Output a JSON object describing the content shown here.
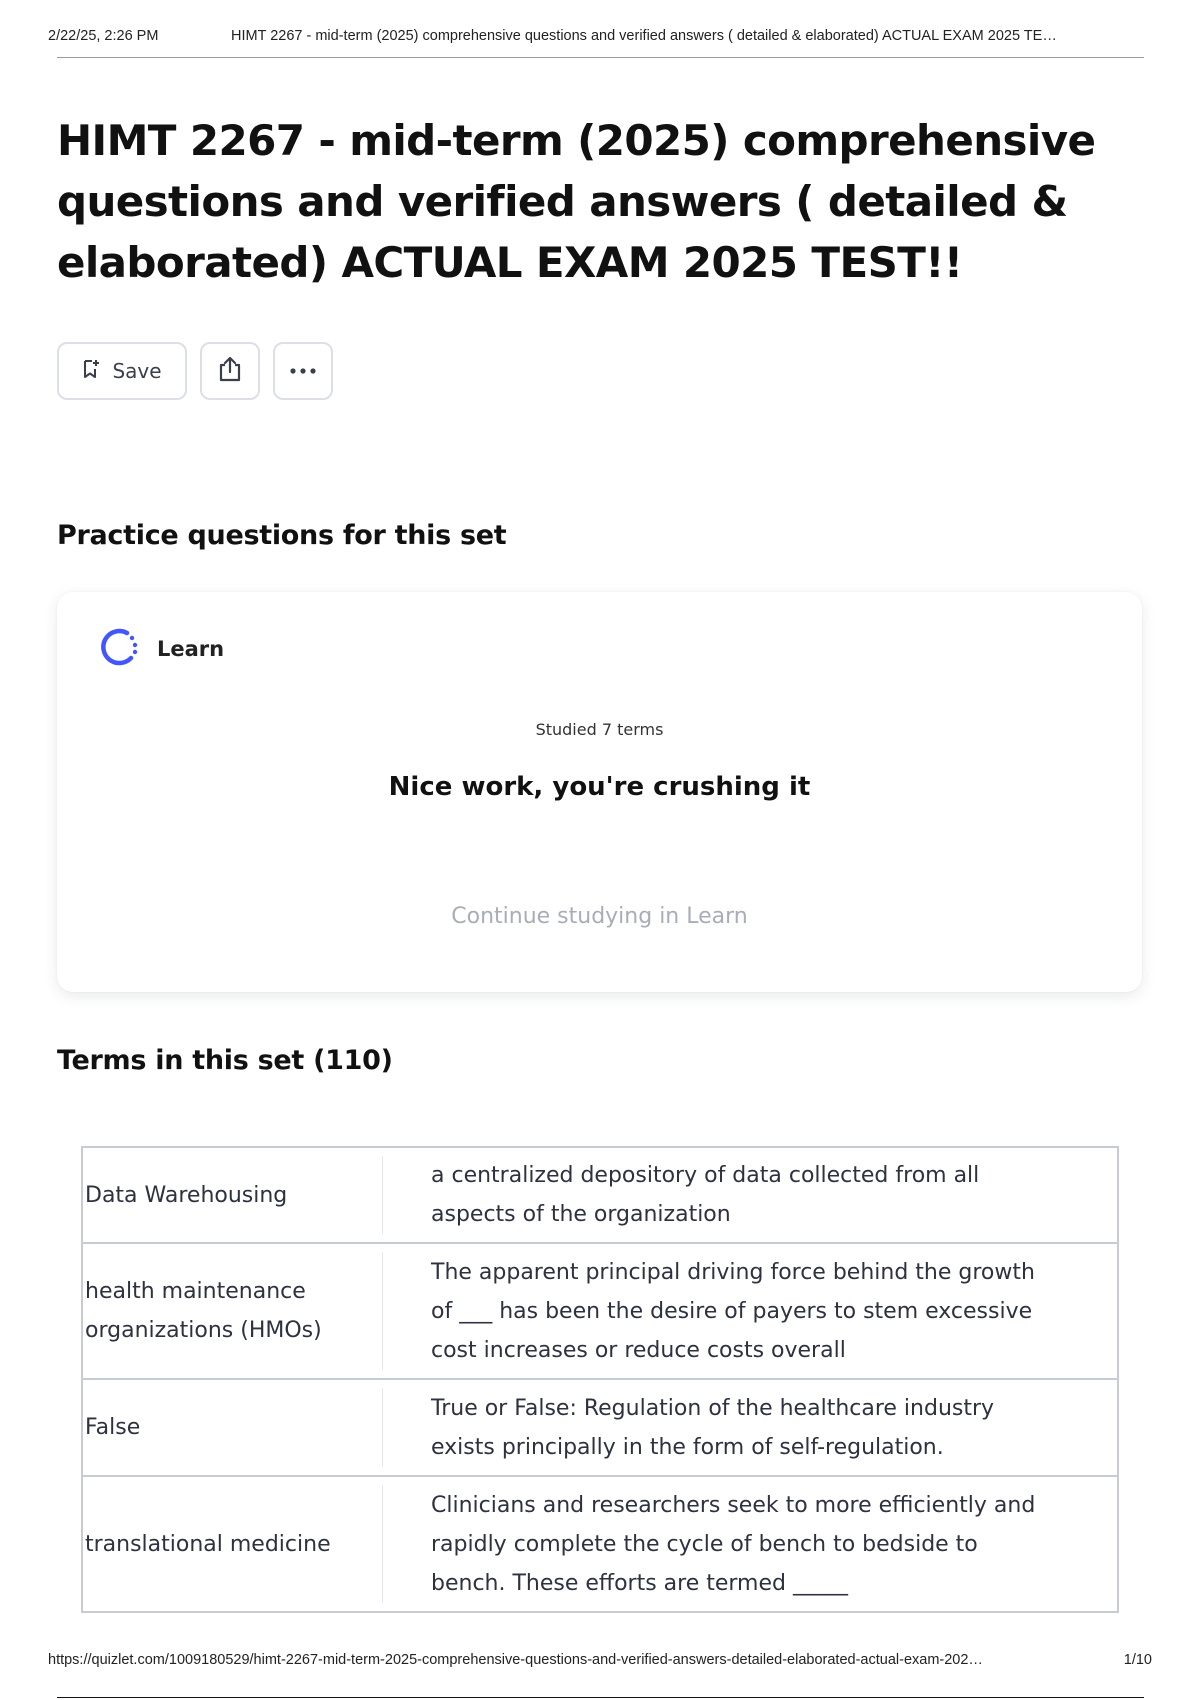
{
  "print_header": {
    "datetime": "2/22/25, 2:26 PM",
    "doc_title": "HIMT 2267 - mid-term (2025) comprehensive questions and verified answers ( detailed & elaborated) ACTUAL EXAM 2025 TE…"
  },
  "page": {
    "title": "HIMT 2267 - mid-term (2025) comprehensive questions and verified answers ( detailed & elaborated) ACTUAL EXAM 2025 TEST!!"
  },
  "actions": {
    "save_label": "Save",
    "save_icon": "bookmark-add-icon",
    "share_icon": "share-icon",
    "more_icon": "more-horizontal-icon"
  },
  "practice": {
    "heading": "Practice questions for this set",
    "learn_label": "Learn",
    "learn_icon": "learn-progress-icon",
    "accent_color": "#4255ff",
    "studied_text": "Studied 7 terms",
    "message": "Nice work, you're crushing it",
    "continue_label": "Continue studying in Learn"
  },
  "terms": {
    "heading": "Terms in this set (110)",
    "rows": [
      {
        "term": "Data Warehousing",
        "definition": "a centralized depository of data collected from all aspects of the organization"
      },
      {
        "term": "health maintenance organizations (HMOs)",
        "definition": "The apparent principal driving force behind the growth of ___ has been the desire of payers to stem excessive cost increases or reduce costs overall"
      },
      {
        "term": "False",
        "definition": "True or False: Regulation of the healthcare industry exists principally in the form of self-regulation."
      },
      {
        "term": "translational medicine",
        "definition": "Clinicians and researchers seek to more efficiently and rapidly complete the cycle of bench to bedside to bench. These efforts are termed _____"
      }
    ]
  },
  "print_footer": {
    "url": "https://quizlet.com/1009180529/himt-2267-mid-term-2025-comprehensive-questions-and-verified-answers-detailed-elaborated-actual-exam-202…",
    "page_num": "1/10"
  }
}
